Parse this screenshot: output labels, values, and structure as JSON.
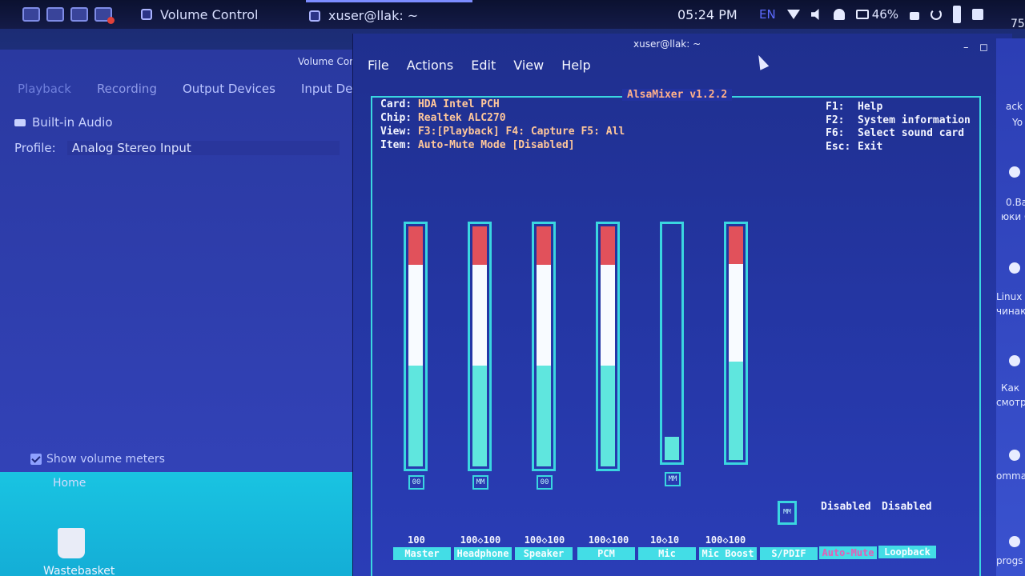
{
  "taskbar": {
    "volume_task": "Volume Control",
    "terminal_task": "xuser@llak: ~",
    "clock": "05:24 PM",
    "lang": "EN",
    "battery": "46%"
  },
  "volume_control": {
    "title": "Volume Con",
    "tabs": [
      "Playback",
      "Recording",
      "Output Devices",
      "Input Device"
    ],
    "device": "Built-in Audio",
    "profile_label": "Profile:",
    "profile_value": "Analog Stereo Input",
    "meters_label": "Show volume meters"
  },
  "desktop": {
    "home": "Home",
    "wastebasket": "Wastebasket"
  },
  "terminal": {
    "title": "xuser@llak: ~",
    "menu": [
      "File",
      "Actions",
      "Edit",
      "View",
      "Help"
    ],
    "window_buttons": [
      "–",
      "◻",
      "✕"
    ]
  },
  "alsamixer": {
    "title": "AlsaMixer v1.2.2",
    "info": [
      {
        "key": "Card:",
        "value": "HDA Intel PCH"
      },
      {
        "key": "Chip:",
        "value": "Realtek ALC270"
      },
      {
        "key": "View:",
        "value": "F3:[Playback] F4: Capture  F5: All"
      },
      {
        "key": "Item:",
        "value": "Auto-Mute Mode [Disabled]"
      }
    ],
    "keys": [
      {
        "key": "F1:",
        "action": "Help"
      },
      {
        "key": "F2:",
        "action": "System information"
      },
      {
        "key": "F6:",
        "action": "Select sound card"
      },
      {
        "key": "Esc:",
        "action": "Exit"
      }
    ],
    "controls": [
      {
        "label": "Master",
        "values": "100",
        "level": 1.0,
        "mute": "00"
      },
      {
        "label": "Headphone",
        "values": "100◇100",
        "level": 1.0,
        "mute": "MM"
      },
      {
        "label": "Speaker",
        "values": "100◇100",
        "level": 1.0,
        "mute": "00"
      },
      {
        "label": "PCM",
        "values": "100◇100",
        "level": 1.0,
        "mute": ""
      },
      {
        "label": "Mic",
        "values": "10◇10",
        "level": 0.1,
        "mute": "MM"
      },
      {
        "label": "Mic Boost",
        "values": "100◇100",
        "level": 1.0,
        "mute": ""
      }
    ],
    "switches": [
      {
        "label": "S/PDIF",
        "status": "",
        "mute": "MM"
      },
      {
        "label": "Auto-Mute",
        "status": "Disabled",
        "mute": ""
      },
      {
        "label": "Loopback",
        "status": "Disabled",
        "mute": ""
      }
    ]
  },
  "right_window": {
    "texts": [
      "ack",
      "Yo",
      "0.Ba",
      "юки С",
      "Linux",
      "чинак",
      "Как",
      "смотре",
      "ommand",
      "progs"
    ],
    "number": "75"
  }
}
